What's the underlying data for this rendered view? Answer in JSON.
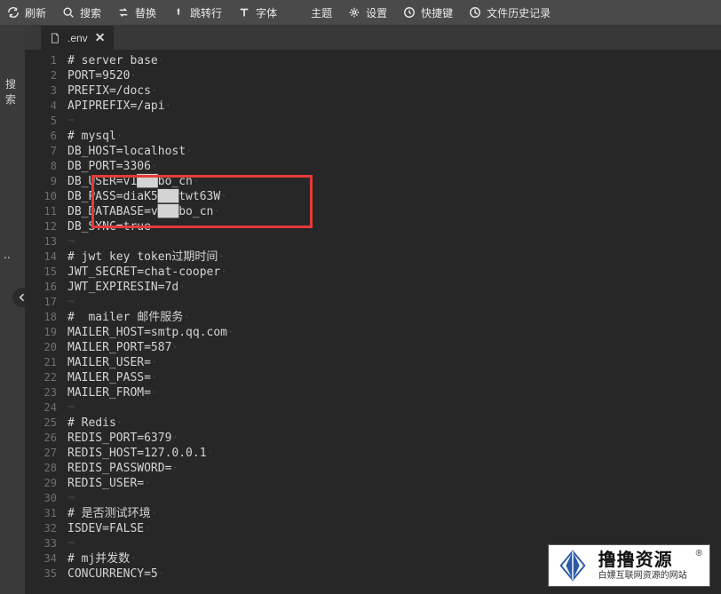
{
  "toolbar": [
    {
      "icon": "refresh-icon",
      "label": "刷新"
    },
    {
      "icon": "search-icon",
      "label": "搜索"
    },
    {
      "icon": "replace-icon",
      "label": "替换"
    },
    {
      "icon": "goto-icon",
      "label": "跳转行"
    },
    {
      "icon": "font-icon",
      "label": "字体"
    },
    {
      "icon": "theme-icon",
      "label": "主题"
    },
    {
      "icon": "settings-icon",
      "label": "设置"
    },
    {
      "icon": "shortcut-icon",
      "label": "快捷键"
    },
    {
      "icon": "history-icon",
      "label": "文件历史记录"
    }
  ],
  "leftPanel": {
    "search_label": "搜索",
    "dots": ".."
  },
  "tab": {
    "filename": ".env"
  },
  "code": {
    "lines": [
      "# server base",
      "PORT=9520",
      "PREFIX=/docs",
      "APIPREFIX=/api",
      "",
      "# mysql",
      "DB_HOST=localhost",
      "DB_PORT=3306",
      "DB_USER=v1███bo_cn",
      "DB_PASS=diaK5███twt63W",
      "DB_DATABASE=v███bo_cn",
      "DB_SYNC=true",
      "",
      "# jwt key token过期时间",
      "JWT_SECRET=chat-cooper",
      "JWT_EXPIRESIN=7d",
      "",
      "#  mailer 邮件服务",
      "MAILER_HOST=smtp.qq.com",
      "MAILER_PORT=587",
      "MAILER_USER=",
      "MAILER_PASS=",
      "MAILER_FROM=",
      "",
      "# Redis",
      "REDIS_PORT=6379",
      "REDIS_HOST=127.0.0.1",
      "REDIS_PASSWORD=",
      "REDIS_USER=",
      "",
      "# 是否测试环境",
      "ISDEV=FALSE",
      "",
      "# mj并发数",
      "CONCURRENCY=5"
    ]
  },
  "watermark": {
    "title": "撸撸资源",
    "subtitle": "白嫖互联网资源的网站"
  }
}
